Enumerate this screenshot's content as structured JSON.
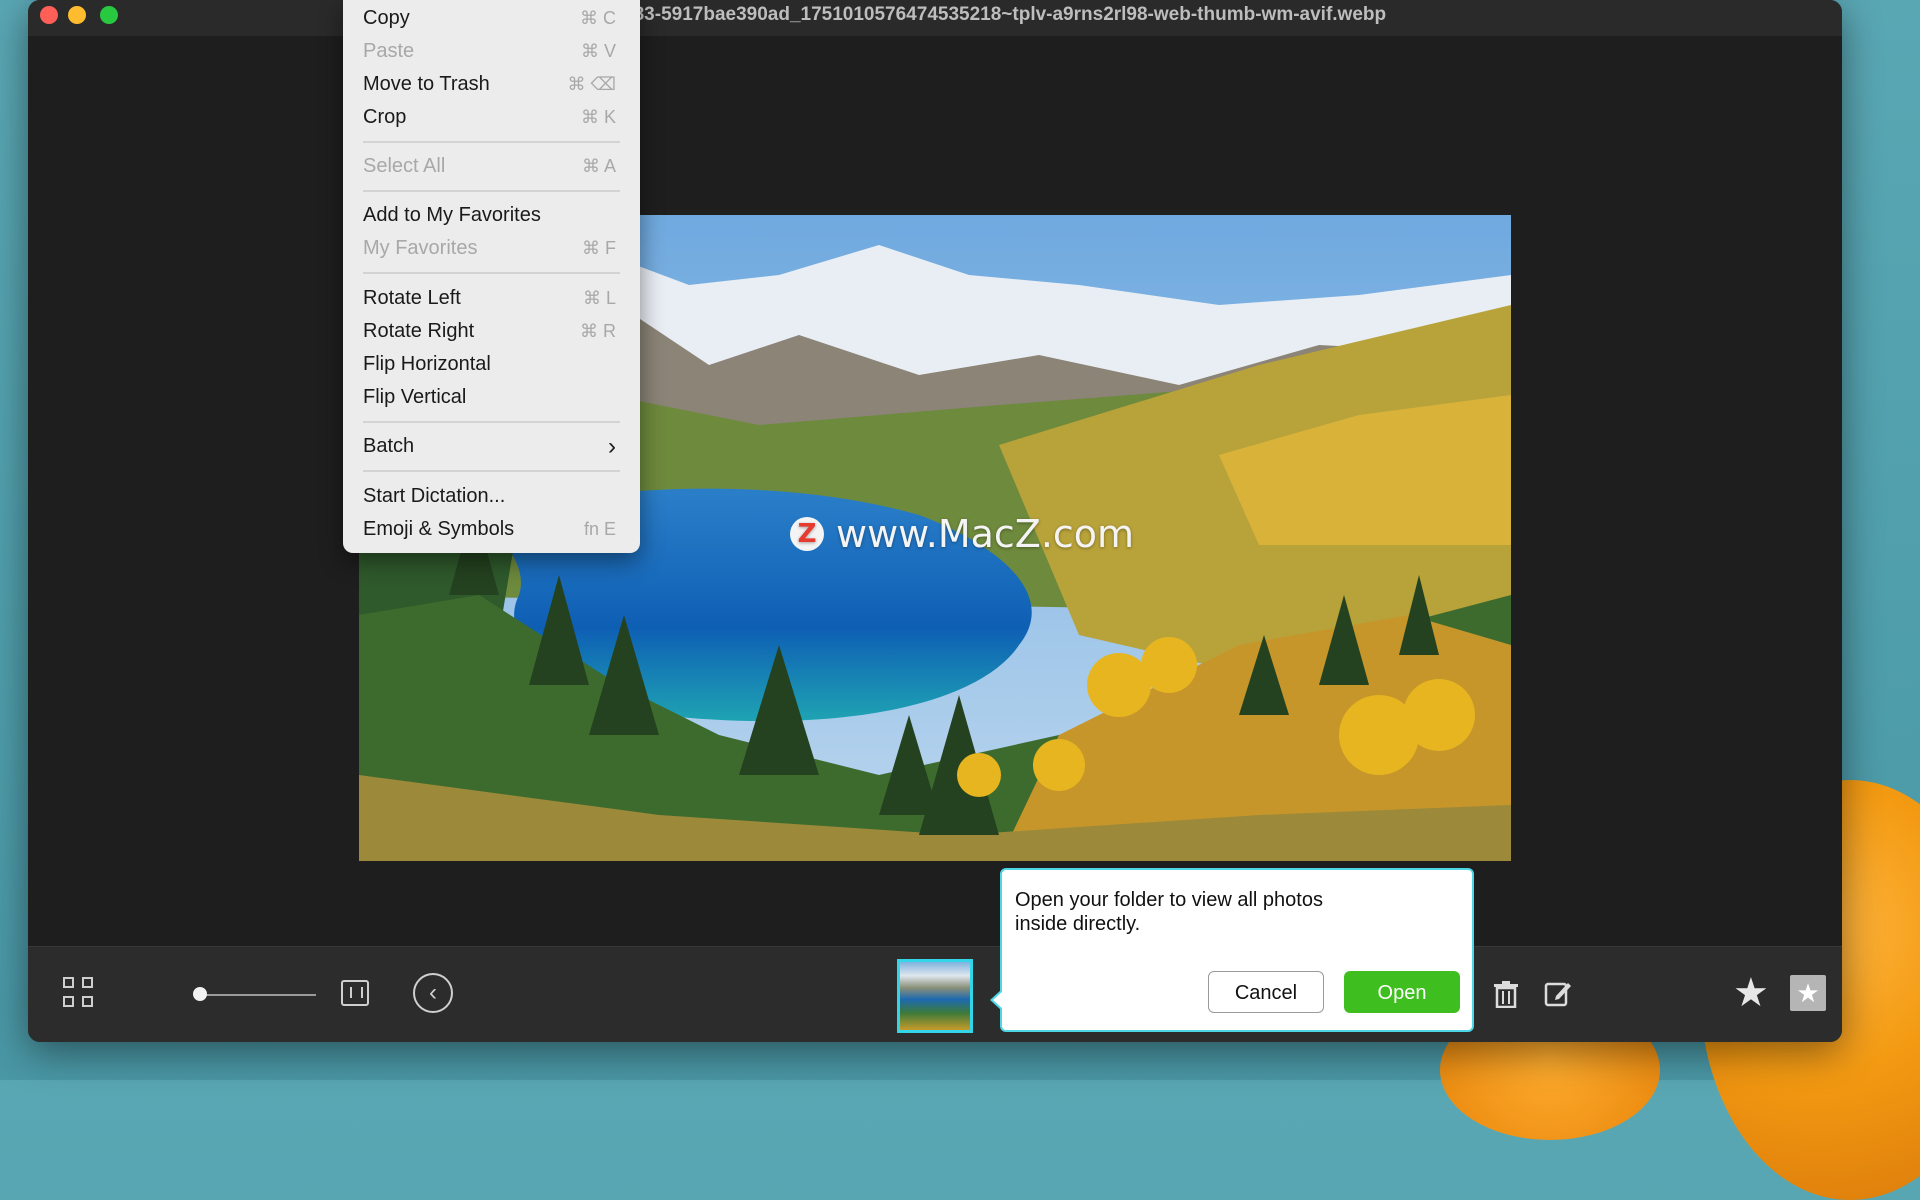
{
  "window": {
    "title": "b83-5917bae390ad_1751010576474535218~tplv-a9rns2rl98-web-thumb-wm-avif.webp"
  },
  "context_menu": {
    "items": [
      {
        "label": "Copy",
        "shortcut": "⌘ C",
        "enabled": true
      },
      {
        "label": "Paste",
        "shortcut": "⌘ V",
        "enabled": false
      },
      {
        "label": "Move to Trash",
        "shortcut": "⌘ ⌫",
        "enabled": true
      },
      {
        "label": "Crop",
        "shortcut": "⌘ K",
        "enabled": true
      },
      {
        "label": "Select All",
        "shortcut": "⌘ A",
        "enabled": false
      },
      {
        "label": "Add to My Favorites",
        "shortcut": "",
        "enabled": true
      },
      {
        "label": "My Favorites",
        "shortcut": "⌘ F",
        "enabled": false
      },
      {
        "label": "Rotate Left",
        "shortcut": "⌘ L",
        "enabled": true
      },
      {
        "label": "Rotate Right",
        "shortcut": "⌘ R",
        "enabled": true
      },
      {
        "label": "Flip Horizontal",
        "shortcut": "",
        "enabled": true
      },
      {
        "label": "Flip Vertical",
        "shortcut": "",
        "enabled": true
      },
      {
        "label": "Batch",
        "shortcut": "›",
        "enabled": true
      },
      {
        "label": "Start Dictation...",
        "shortcut": "",
        "enabled": true
      },
      {
        "label": "Emoji & Symbols",
        "shortcut": "fn E",
        "enabled": true
      }
    ]
  },
  "photo": {
    "watermark_text": "www.MacZ.com",
    "watermark_logo_letter": "Z"
  },
  "popover": {
    "message": "Open your folder to view all photos inside directly.",
    "cancel_label": "Cancel",
    "open_label": "Open"
  },
  "toolbar": {
    "star_glyph": "★",
    "favorite_glyph": "★",
    "prev_glyph": "‹",
    "zoom_level": 0.0
  },
  "colors": {
    "accent_cyan": "#4dd7e6",
    "open_green": "#3fbf1f",
    "close_red": "#fe5f57",
    "minimize_yellow": "#febc2e",
    "maximize_green": "#28c840"
  }
}
